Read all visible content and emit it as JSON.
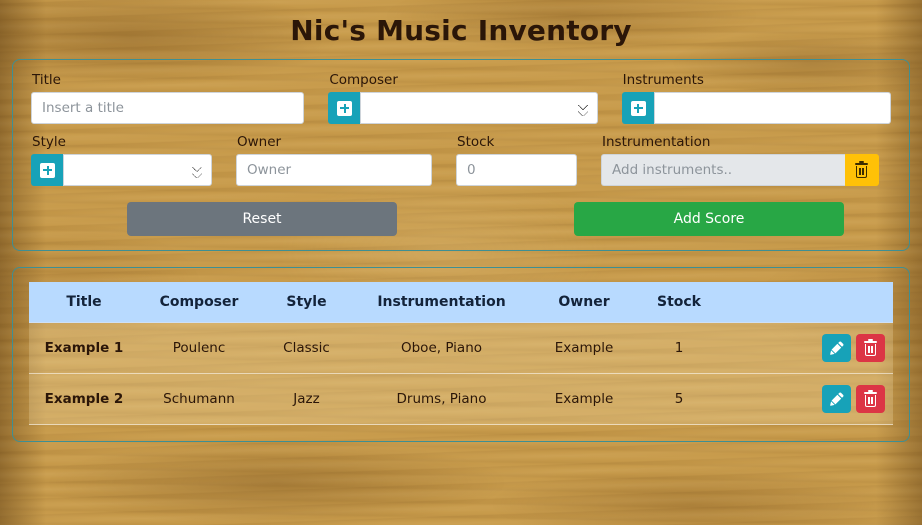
{
  "app": {
    "title": "Nic's Music Inventory"
  },
  "theme": {
    "accent_teal": "#17a2b8",
    "border_teal": "#3e8f93",
    "success_green": "#28a745",
    "secondary_gray": "#6c757d",
    "warning_yellow": "#ffc107",
    "danger_red": "#dc3545",
    "table_header_blue": "#b8daff"
  },
  "form": {
    "fields": {
      "title": {
        "label": "Title",
        "placeholder": "Insert a title",
        "value": ""
      },
      "composer": {
        "label": "Composer",
        "add_icon": "plus-icon",
        "value": "",
        "options": [
          ""
        ]
      },
      "instruments": {
        "label": "Instruments",
        "add_icon": "plus-icon",
        "value": "",
        "options": [
          ""
        ]
      },
      "style": {
        "label": "Style",
        "add_icon": "plus-icon",
        "value": "",
        "options": [
          ""
        ]
      },
      "owner": {
        "label": "Owner",
        "placeholder": "Owner",
        "value": ""
      },
      "stock": {
        "label": "Stock",
        "placeholder": "0",
        "value": ""
      },
      "instrumentation": {
        "label": "Instrumentation",
        "placeholder": "Add instruments..",
        "value": "",
        "clear_icon": "trash-icon"
      }
    },
    "buttons": {
      "reset": "Reset",
      "add_score": "Add Score"
    }
  },
  "table": {
    "columns": [
      "Title",
      "Composer",
      "Style",
      "Instrumentation",
      "Owner",
      "Stock",
      ""
    ],
    "rows": [
      {
        "title": "Example 1",
        "composer": "Poulenc",
        "style": "Classic",
        "instrumentation": "Oboe, Piano",
        "owner": "Example",
        "stock": "1",
        "edit_icon": "pencil-icon",
        "delete_icon": "trash-icon"
      },
      {
        "title": "Example 2",
        "composer": "Schumann",
        "style": "Jazz",
        "instrumentation": "Drums, Piano",
        "owner": "Example",
        "stock": "5",
        "edit_icon": "pencil-icon",
        "delete_icon": "trash-icon"
      }
    ]
  }
}
